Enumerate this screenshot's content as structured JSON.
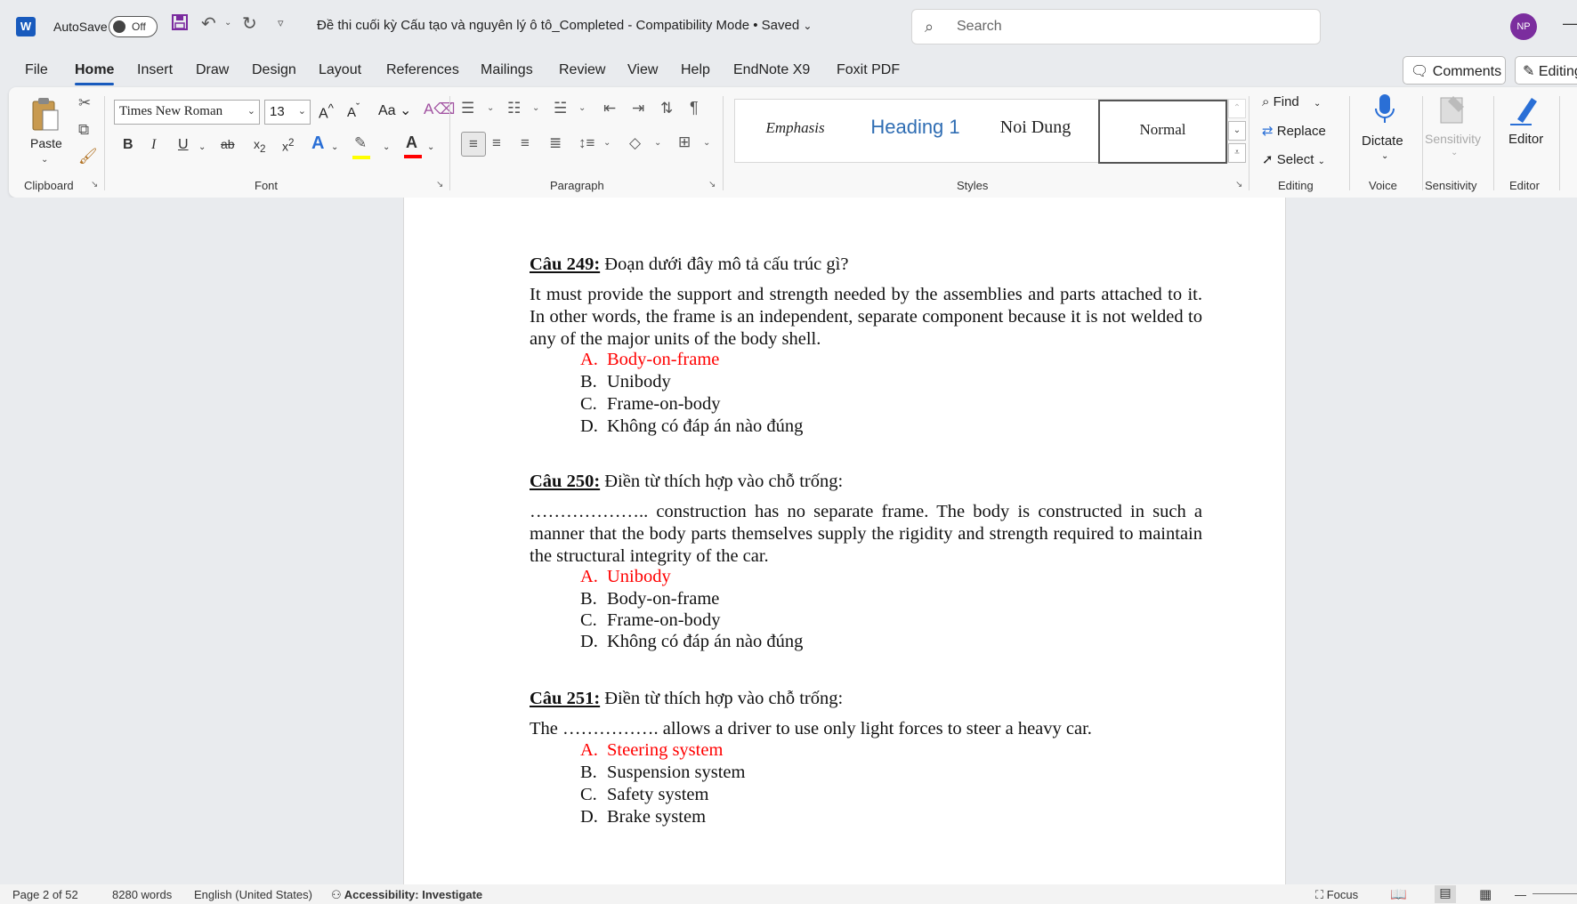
{
  "titlebar": {
    "app_icon": "word-icon",
    "autosave_label": "AutoSave",
    "autosave_state": "Off",
    "doc_title": "Đề thi cuối kỳ Cấu tạo và nguyên lý ô tô_Completed  -  Compatibility Mode • Saved",
    "search_placeholder": "Search",
    "user_initials": "NP"
  },
  "menu": {
    "tabs": [
      "File",
      "Home",
      "Insert",
      "Draw",
      "Design",
      "Layout",
      "References",
      "Mailings",
      "Review",
      "View",
      "Help",
      "EndNote X9",
      "Foxit PDF"
    ],
    "active": "Home",
    "comments_label": "Comments",
    "editing_label": "Editing"
  },
  "ribbon": {
    "clipboard": {
      "paste_label": "Paste",
      "group_label": "Clipboard"
    },
    "font": {
      "family": "Times New Roman",
      "size": "13",
      "group_label": "Font",
      "highlight_color": "#ffff00",
      "font_color": "#ff0000"
    },
    "paragraph": {
      "group_label": "Paragraph"
    },
    "styles": {
      "items": [
        "Emphasis",
        "Heading 1",
        "Noi Dung",
        "Normal"
      ],
      "selected": "Normal",
      "group_label": "Styles"
    },
    "editing": {
      "find": "Find",
      "replace": "Replace",
      "select": "Select",
      "group_label": "Editing"
    },
    "voice": {
      "dictate": "Dictate",
      "group_label": "Voice"
    },
    "sensitivity": {
      "button": "Sensitivity",
      "group_label": "Sensitivity"
    },
    "editor": {
      "button": "Editor",
      "group_label": "Editor"
    }
  },
  "document": {
    "answer_color": "#ff0000",
    "questions": [
      {
        "number": "Câu 249:",
        "prompt": " Đoạn dưới đây mô tả cấu trúc gì?",
        "body": "It must provide the support and strength needed by the assemblies and parts attached to it. In other words, the frame is an independent, separate component because it is not welded to any of the major units of the body shell.",
        "options": [
          {
            "letter": "A.",
            "text": "Body-on-frame",
            "correct": true
          },
          {
            "letter": "B.",
            "text": "Unibody",
            "correct": false
          },
          {
            "letter": "C.",
            "text": "Frame-on-body",
            "correct": false
          },
          {
            "letter": "D.",
            "text": "Không có đáp án nào đúng",
            "correct": false
          }
        ]
      },
      {
        "number": "Câu 250:",
        "prompt": " Điền từ thích hợp vào chỗ trống:",
        "body": "……………….. construction has no separate frame. The body is constructed in such a manner that the body parts themselves supply the rigidity and strength required to maintain the structural integrity of the car.",
        "options": [
          {
            "letter": "A.",
            "text": "Unibody",
            "correct": true
          },
          {
            "letter": "B.",
            "text": "Body-on-frame",
            "correct": false
          },
          {
            "letter": "C.",
            "text": "Frame-on-body",
            "correct": false
          },
          {
            "letter": "D.",
            "text": "Không có đáp án nào đúng",
            "correct": false
          }
        ]
      },
      {
        "number": "Câu 251:",
        "prompt": " Điền từ thích hợp vào chỗ trống:",
        "body": "The ……………. allows a driver to use only light forces to steer a heavy car.",
        "options": [
          {
            "letter": "A.",
            "text": "Steering system",
            "correct": true
          },
          {
            "letter": "B.",
            "text": "Suspension system",
            "correct": false
          },
          {
            "letter": "C.",
            "text": "Safety system",
            "correct": false
          },
          {
            "letter": "D.",
            "text": "Brake system",
            "correct": false
          }
        ]
      }
    ]
  },
  "statusbar": {
    "page": "Page 2 of 52",
    "words": "8280 words",
    "language": "English (United States)",
    "accessibility": "Accessibility: Investigate",
    "focus": "Focus"
  }
}
